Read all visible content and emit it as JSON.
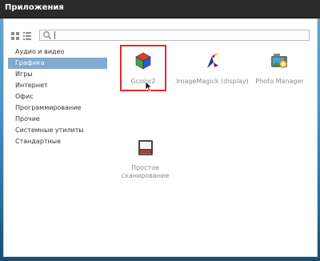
{
  "window": {
    "title": "Приложения"
  },
  "search": {
    "value": "",
    "placeholder": ""
  },
  "categories": [
    {
      "label": "Аудио и видео",
      "selected": false
    },
    {
      "label": "Графика",
      "selected": true
    },
    {
      "label": "Игры",
      "selected": false
    },
    {
      "label": "Интернет",
      "selected": false
    },
    {
      "label": "Офис",
      "selected": false
    },
    {
      "label": "Программирование",
      "selected": false
    },
    {
      "label": "Прочие",
      "selected": false
    },
    {
      "label": "Системные утилиты",
      "selected": false
    },
    {
      "label": "Стандартные",
      "selected": false
    }
  ],
  "apps": [
    {
      "label": "Gcolor2",
      "icon": "gcolor2-cube-icon",
      "highlighted": true
    },
    {
      "label": "ImageMagick (display)",
      "icon": "imagemagick-wizard-icon",
      "highlighted": false
    },
    {
      "label": "Photo Manager",
      "icon": "photo-manager-icon",
      "highlighted": false
    },
    {
      "label": "Простое сканирование",
      "icon": "scanner-icon",
      "highlighted": false
    }
  ],
  "colors": {
    "selection": "#82a9d0",
    "highlight_box": "#e02b2b",
    "titlebar": "#2a2a2a"
  }
}
